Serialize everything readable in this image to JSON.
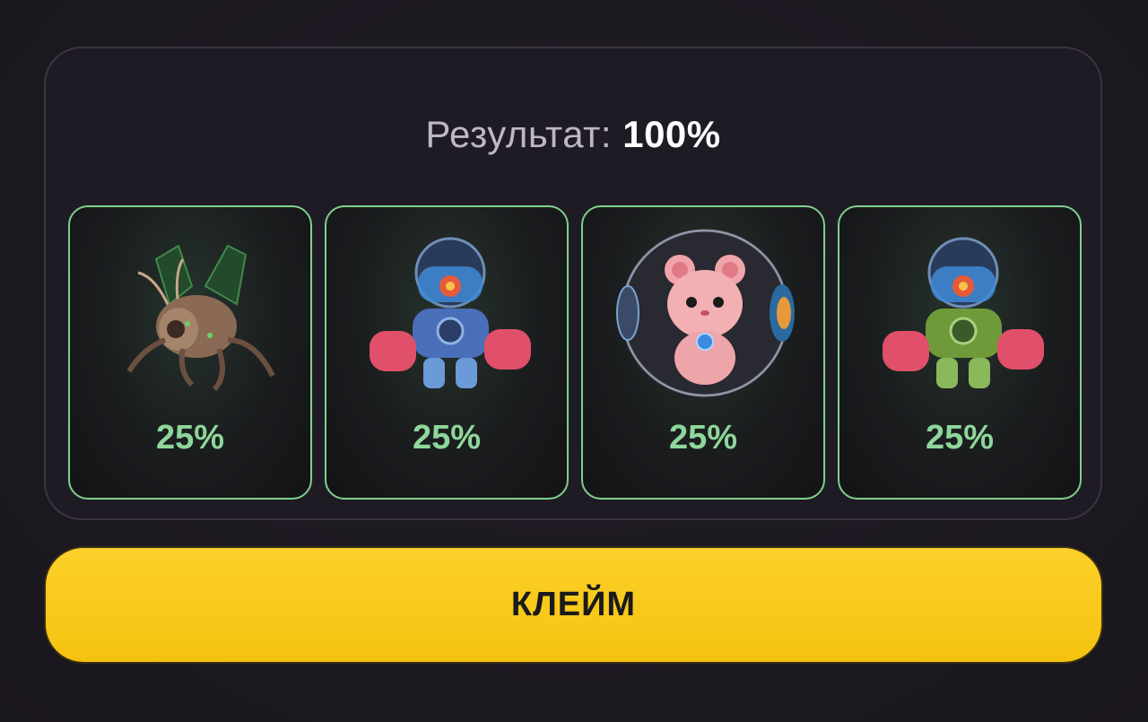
{
  "result": {
    "label": "Результат:",
    "value": "100%"
  },
  "cards": [
    {
      "name": "insect-robot",
      "percent": "25%"
    },
    {
      "name": "blue-mech-robot",
      "percent": "25%"
    },
    {
      "name": "hamster-ball",
      "percent": "25%"
    },
    {
      "name": "green-mech-robot",
      "percent": "25%"
    }
  ],
  "claim_button": {
    "label": "КЛЕЙМ"
  },
  "colors": {
    "card_border": "#7fd08b",
    "percent_text": "#8ed69a",
    "button_yellow": "#f8c71a",
    "background": "#1d1921"
  }
}
